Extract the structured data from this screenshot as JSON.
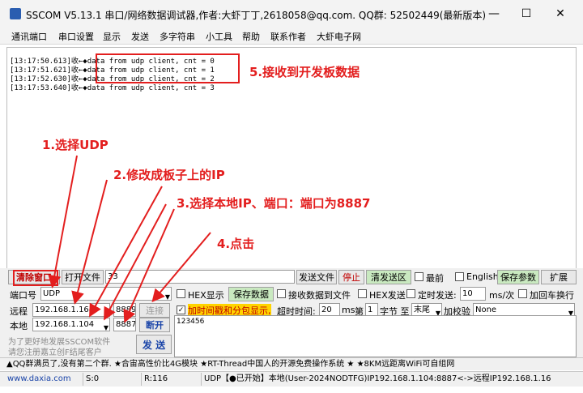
{
  "window": {
    "title": "SSCOM V5.13.1 串口/网络数据调试器,作者:大虾丁丁,2618058@qq.com. QQ群: 52502449(最新版本)",
    "minimize": "—",
    "maximize": "☐",
    "close": "✕"
  },
  "menu": [
    "通讯端口",
    "串口设置",
    "显示",
    "发送",
    "多字符串",
    "小工具",
    "帮助",
    "联系作者",
    "大虾电子网"
  ],
  "log_lines": [
    "[13:17:50.613]收←◆data from udp client, cnt = 0",
    "[13:17:51.621]收←◆data from udp client, cnt = 1",
    "[13:17:52.630]收←◆data from udp client, cnt = 2",
    "[13:17:53.640]收←◆data from udp client, cnt = 3"
  ],
  "annotations": {
    "a1": "1.选择UDP",
    "a2": "2.修改成板子上的IP",
    "a3": "3.选择本地IP、端口：端口为8887",
    "a4": "4.点击",
    "a5": "5.接收到开发板数据"
  },
  "controls": {
    "clear_window": "清除窗口",
    "open_file": "打开文件",
    "file_path": "33",
    "send_file": "发送文件",
    "stop": "停止",
    "clear_send": "清发送区",
    "latest": "最前",
    "english": "English",
    "save_params": "保存参数",
    "expand": "扩展",
    "port_label": "端口号",
    "port_value": "UDP",
    "hex_display": "HEX显示",
    "save_data": "保存数据",
    "recv_to_file": "接收数据到文件",
    "hex_send": "HEX发送",
    "timed_send": "定时发送:",
    "timed_value": "10",
    "timed_unit": "ms/次",
    "add_crlf": "加回车换行",
    "remote_label": "远程",
    "remote_ip": "192.168.1.164",
    "remote_port": "8889",
    "connect": "连接",
    "add_timestamp": "加时间戳和分包显示,",
    "timeout_label": "超时时间:",
    "timeout_value": "20",
    "timeout_unit": "ms",
    "nth_label": "第",
    "nth_value": "1",
    "byte_label": "字节 至",
    "end_value": "末尾",
    "checksum_label": "加校验",
    "checksum_value": "None",
    "local_label": "本地",
    "local_ip": "192.168.1.104",
    "local_port": "8887",
    "disconnect": "断开",
    "send": "发 送",
    "send_text": "123456",
    "promo_line1": "为了更好地发展SSCOM软件",
    "promo_line2": "请您注册嘉立创F结尾客户"
  },
  "ticker": "▲QQ群满员了,没有第二个群. ★合宙高性价比4G模块 ★RT-Thread中国人的开源免费操作系统 ★ ★8KM远距离WiFi可自组网",
  "status": {
    "website": "www.daxia.com",
    "sent": "S:0",
    "received": "R:116",
    "connection": "UDP【●已开始】本地(User-2024NODTFG)IP192.168.1.104:8887<->远程IP192.168.1.16"
  },
  "colors": {
    "annotation": "#e31e1e",
    "green_button": "#c9e9c0",
    "connect_text": "#1a44a8"
  }
}
